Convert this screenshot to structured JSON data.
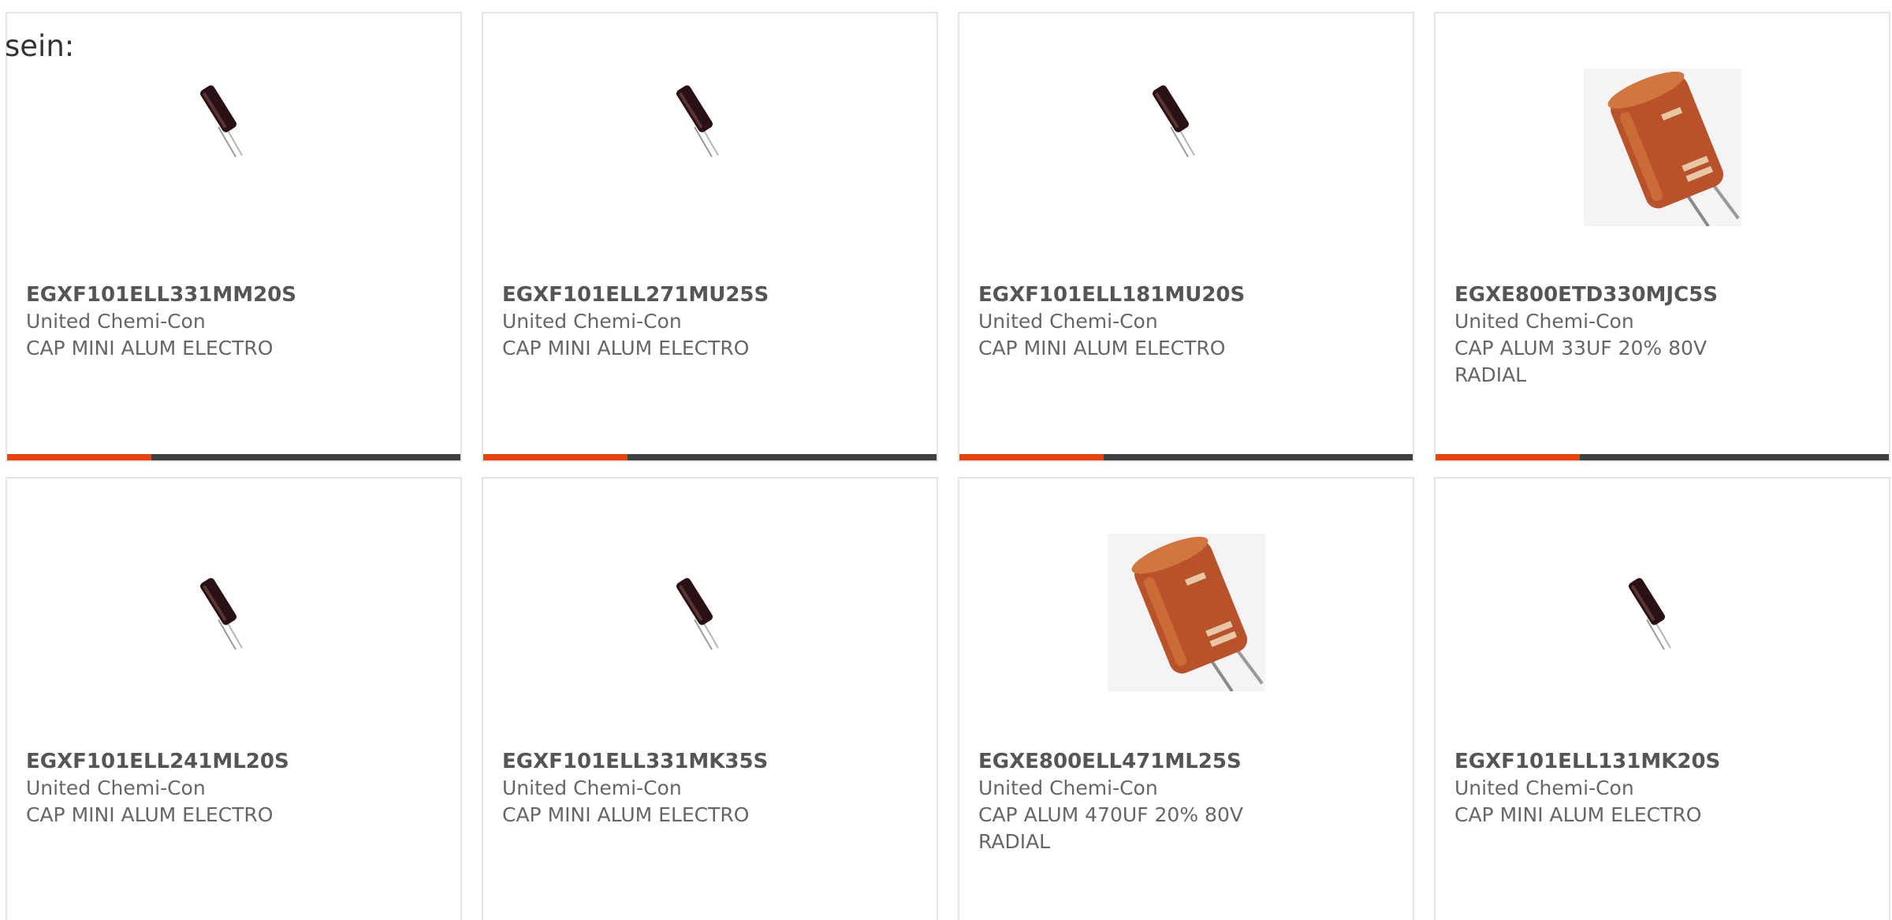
{
  "intro_text": "sein:",
  "colors": {
    "accent": "#e8420f",
    "bar_track": "#404040",
    "card_border": "#e4e4e4"
  },
  "products": [
    {
      "part": "EGXF101ELL331MM20S",
      "manufacturer": "United Chemi-Con",
      "description": "CAP MINI ALUM ELECTRO",
      "image": "slim-capacitor-icon"
    },
    {
      "part": "EGXF101ELL271MU25S",
      "manufacturer": "United Chemi-Con",
      "description": "CAP MINI ALUM ELECTRO",
      "image": "slim-capacitor-icon"
    },
    {
      "part": "EGXF101ELL181MU20S",
      "manufacturer": "United Chemi-Con",
      "description": "CAP MINI ALUM ELECTRO",
      "image": "slim-capacitor-icon"
    },
    {
      "part": "EGXE800ETD330MJC5S",
      "manufacturer": "United Chemi-Con",
      "description": "CAP ALUM 33UF 20% 80V RADIAL",
      "image": "radial-capacitor-icon"
    },
    {
      "part": "EGXF101ELL241ML20S",
      "manufacturer": "United Chemi-Con",
      "description": "CAP MINI ALUM ELECTRO",
      "image": "slim-capacitor-icon"
    },
    {
      "part": "EGXF101ELL331MK35S",
      "manufacturer": "United Chemi-Con",
      "description": "CAP MINI ALUM ELECTRO",
      "image": "slim-capacitor-icon"
    },
    {
      "part": "EGXE800ELL471ML25S",
      "manufacturer": "United Chemi-Con",
      "description": "CAP ALUM 470UF 20% 80V RADIAL",
      "image": "radial-capacitor-icon"
    },
    {
      "part": "EGXF101ELL131MK20S",
      "manufacturer": "United Chemi-Con",
      "description": "CAP MINI ALUM ELECTRO",
      "image": "slim-capacitor-icon"
    }
  ]
}
